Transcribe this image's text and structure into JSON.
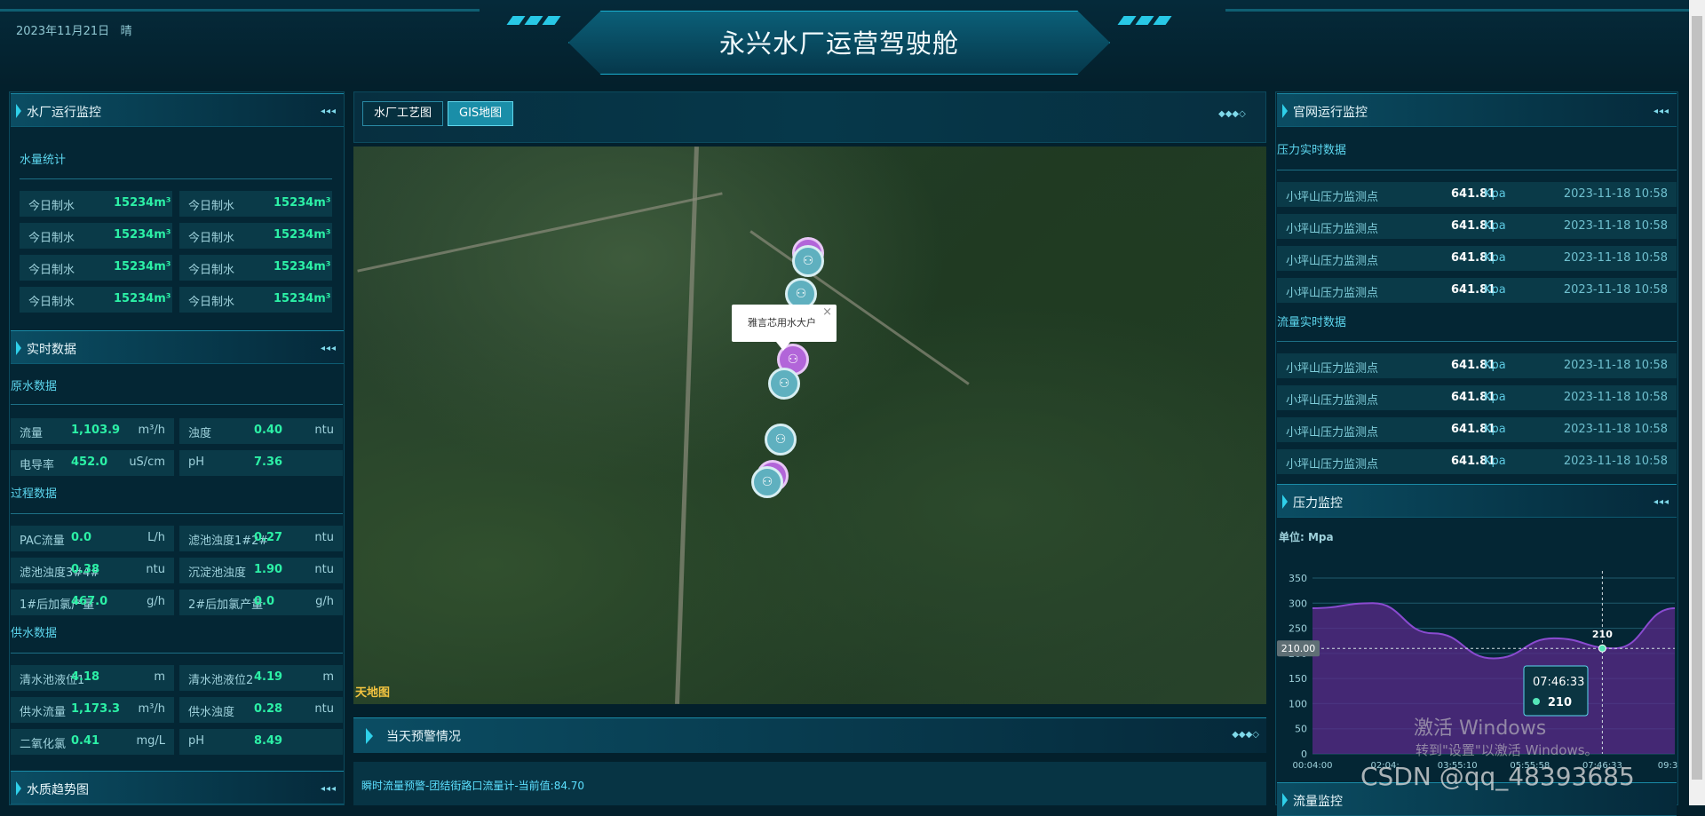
{
  "header": {
    "date": "2023年11月21日",
    "weather": "晴",
    "title": "永兴水厂运营驾驶舱"
  },
  "left": {
    "plant": {
      "title": "水厂运行监控",
      "water_stats_title": "水量统计",
      "stats": [
        {
          "label": "今日制水",
          "value": "15234m³"
        },
        {
          "label": "今日制水",
          "value": "15234m³"
        },
        {
          "label": "今日制水",
          "value": "15234m³"
        },
        {
          "label": "今日制水",
          "value": "15234m³"
        },
        {
          "label": "今日制水",
          "value": "15234m³"
        },
        {
          "label": "今日制水",
          "value": "15234m³"
        },
        {
          "label": "今日制水",
          "value": "15234m³"
        },
        {
          "label": "今日制水",
          "value": "15234m³"
        }
      ]
    },
    "realtime": {
      "title": "实时数据",
      "raw_title": "原水数据",
      "raw": [
        {
          "label": "流量",
          "value": "1,103.9",
          "unit": "m³/h"
        },
        {
          "label": "浊度",
          "value": "0.40",
          "unit": "ntu"
        },
        {
          "label": "电导率",
          "value": "452.0",
          "unit": "uS/cm"
        },
        {
          "label": "pH",
          "value": "7.36",
          "unit": ""
        }
      ],
      "process_title": "过程数据",
      "process": [
        {
          "label": "PAC流量",
          "value": "0.0",
          "unit": "L/h"
        },
        {
          "label": "滤池浊度1#2#",
          "value": "0.27",
          "unit": "ntu"
        },
        {
          "label": "滤池浊度3#4#",
          "value": "0.38",
          "unit": "ntu"
        },
        {
          "label": "沉淀池浊度",
          "value": "1.90",
          "unit": "ntu"
        },
        {
          "label": "1#后加氯产量",
          "value": "467.0",
          "unit": "g/h"
        },
        {
          "label": "2#后加氯产量",
          "value": "0.0",
          "unit": "g/h"
        }
      ],
      "supply_title": "供水数据",
      "supply": [
        {
          "label": "清水池液位1",
          "value": "4.18",
          "unit": "m"
        },
        {
          "label": "清水池液位2",
          "value": "4.19",
          "unit": "m"
        },
        {
          "label": "供水流量",
          "value": "1,173.3",
          "unit": "m³/h"
        },
        {
          "label": "供水浊度",
          "value": "0.28",
          "unit": "ntu"
        },
        {
          "label": "二氧化氯",
          "value": "0.41",
          "unit": "mg/L"
        },
        {
          "label": "pH",
          "value": "8.49",
          "unit": ""
        }
      ]
    },
    "trend_title": "水质趋势图"
  },
  "center": {
    "tabs": [
      "水厂工艺图",
      "GIS地图"
    ],
    "map_popup": "雅言芯用水大户",
    "map_logo": "天地图",
    "alert_title": "当天预警情况",
    "alert_text": "瞬时流量预警-团结街路口流量计-当前值:84.70"
  },
  "right": {
    "title": "官网运行监控",
    "pressure_title": "压力实时数据",
    "flow_title": "流量实时数据",
    "rows": [
      {
        "name": "小坪山压力监测点",
        "value": "641.81",
        "unit": "Kpa",
        "time": "2023-11-18 10:58"
      },
      {
        "name": "小坪山压力监测点",
        "value": "641.81",
        "unit": "Kpa",
        "time": "2023-11-18 10:58"
      },
      {
        "name": "小坪山压力监测点",
        "value": "641.81",
        "unit": "Kpa",
        "time": "2023-11-18 10:58"
      },
      {
        "name": "小坪山压力监测点",
        "value": "641.81",
        "unit": "Kpa",
        "time": "2023-11-18 10:58"
      }
    ],
    "flow_rows": [
      {
        "name": "小坪山压力监测点",
        "value": "641.81",
        "unit": "Kpa",
        "time": "2023-11-18 10:58"
      },
      {
        "name": "小坪山压力监测点",
        "value": "641.81",
        "unit": "Kpa",
        "time": "2023-11-18 10:58"
      },
      {
        "name": "小坪山压力监测点",
        "value": "641.81",
        "unit": "Kpa",
        "time": "2023-11-18 10:58"
      },
      {
        "name": "小坪山压力监测点",
        "value": "641.81",
        "unit": "Kpa",
        "time": "2023-11-18 10:58"
      }
    ],
    "pressure_monitor_title": "压力监控",
    "flow_monitor_title": "流量监控"
  },
  "chart_data": {
    "type": "area",
    "unit_label": "单位: Mpa",
    "x": [
      "00:04:00",
      "02:04:",
      "03:55:10",
      "05:55:58",
      "07:46:33",
      "09:3"
    ],
    "values": [
      290,
      300,
      240,
      190,
      230,
      210,
      290
    ],
    "yticks": [
      0,
      50,
      100,
      150,
      200,
      250,
      300,
      350
    ],
    "ylim": [
      0,
      350
    ],
    "crosshair_value": "210.00",
    "point_label": "210",
    "tooltip": {
      "time": "07:46:33",
      "value": "210"
    },
    "colors": {
      "fill": "#5a2a8a",
      "line": "#8a4bd0",
      "point": "#55e6b8"
    }
  },
  "watermark": {
    "line1": "激活 Windows",
    "line2": "转到\"设置\"以激活 Windows。",
    "csdn": "CSDN @qq_48393685"
  }
}
